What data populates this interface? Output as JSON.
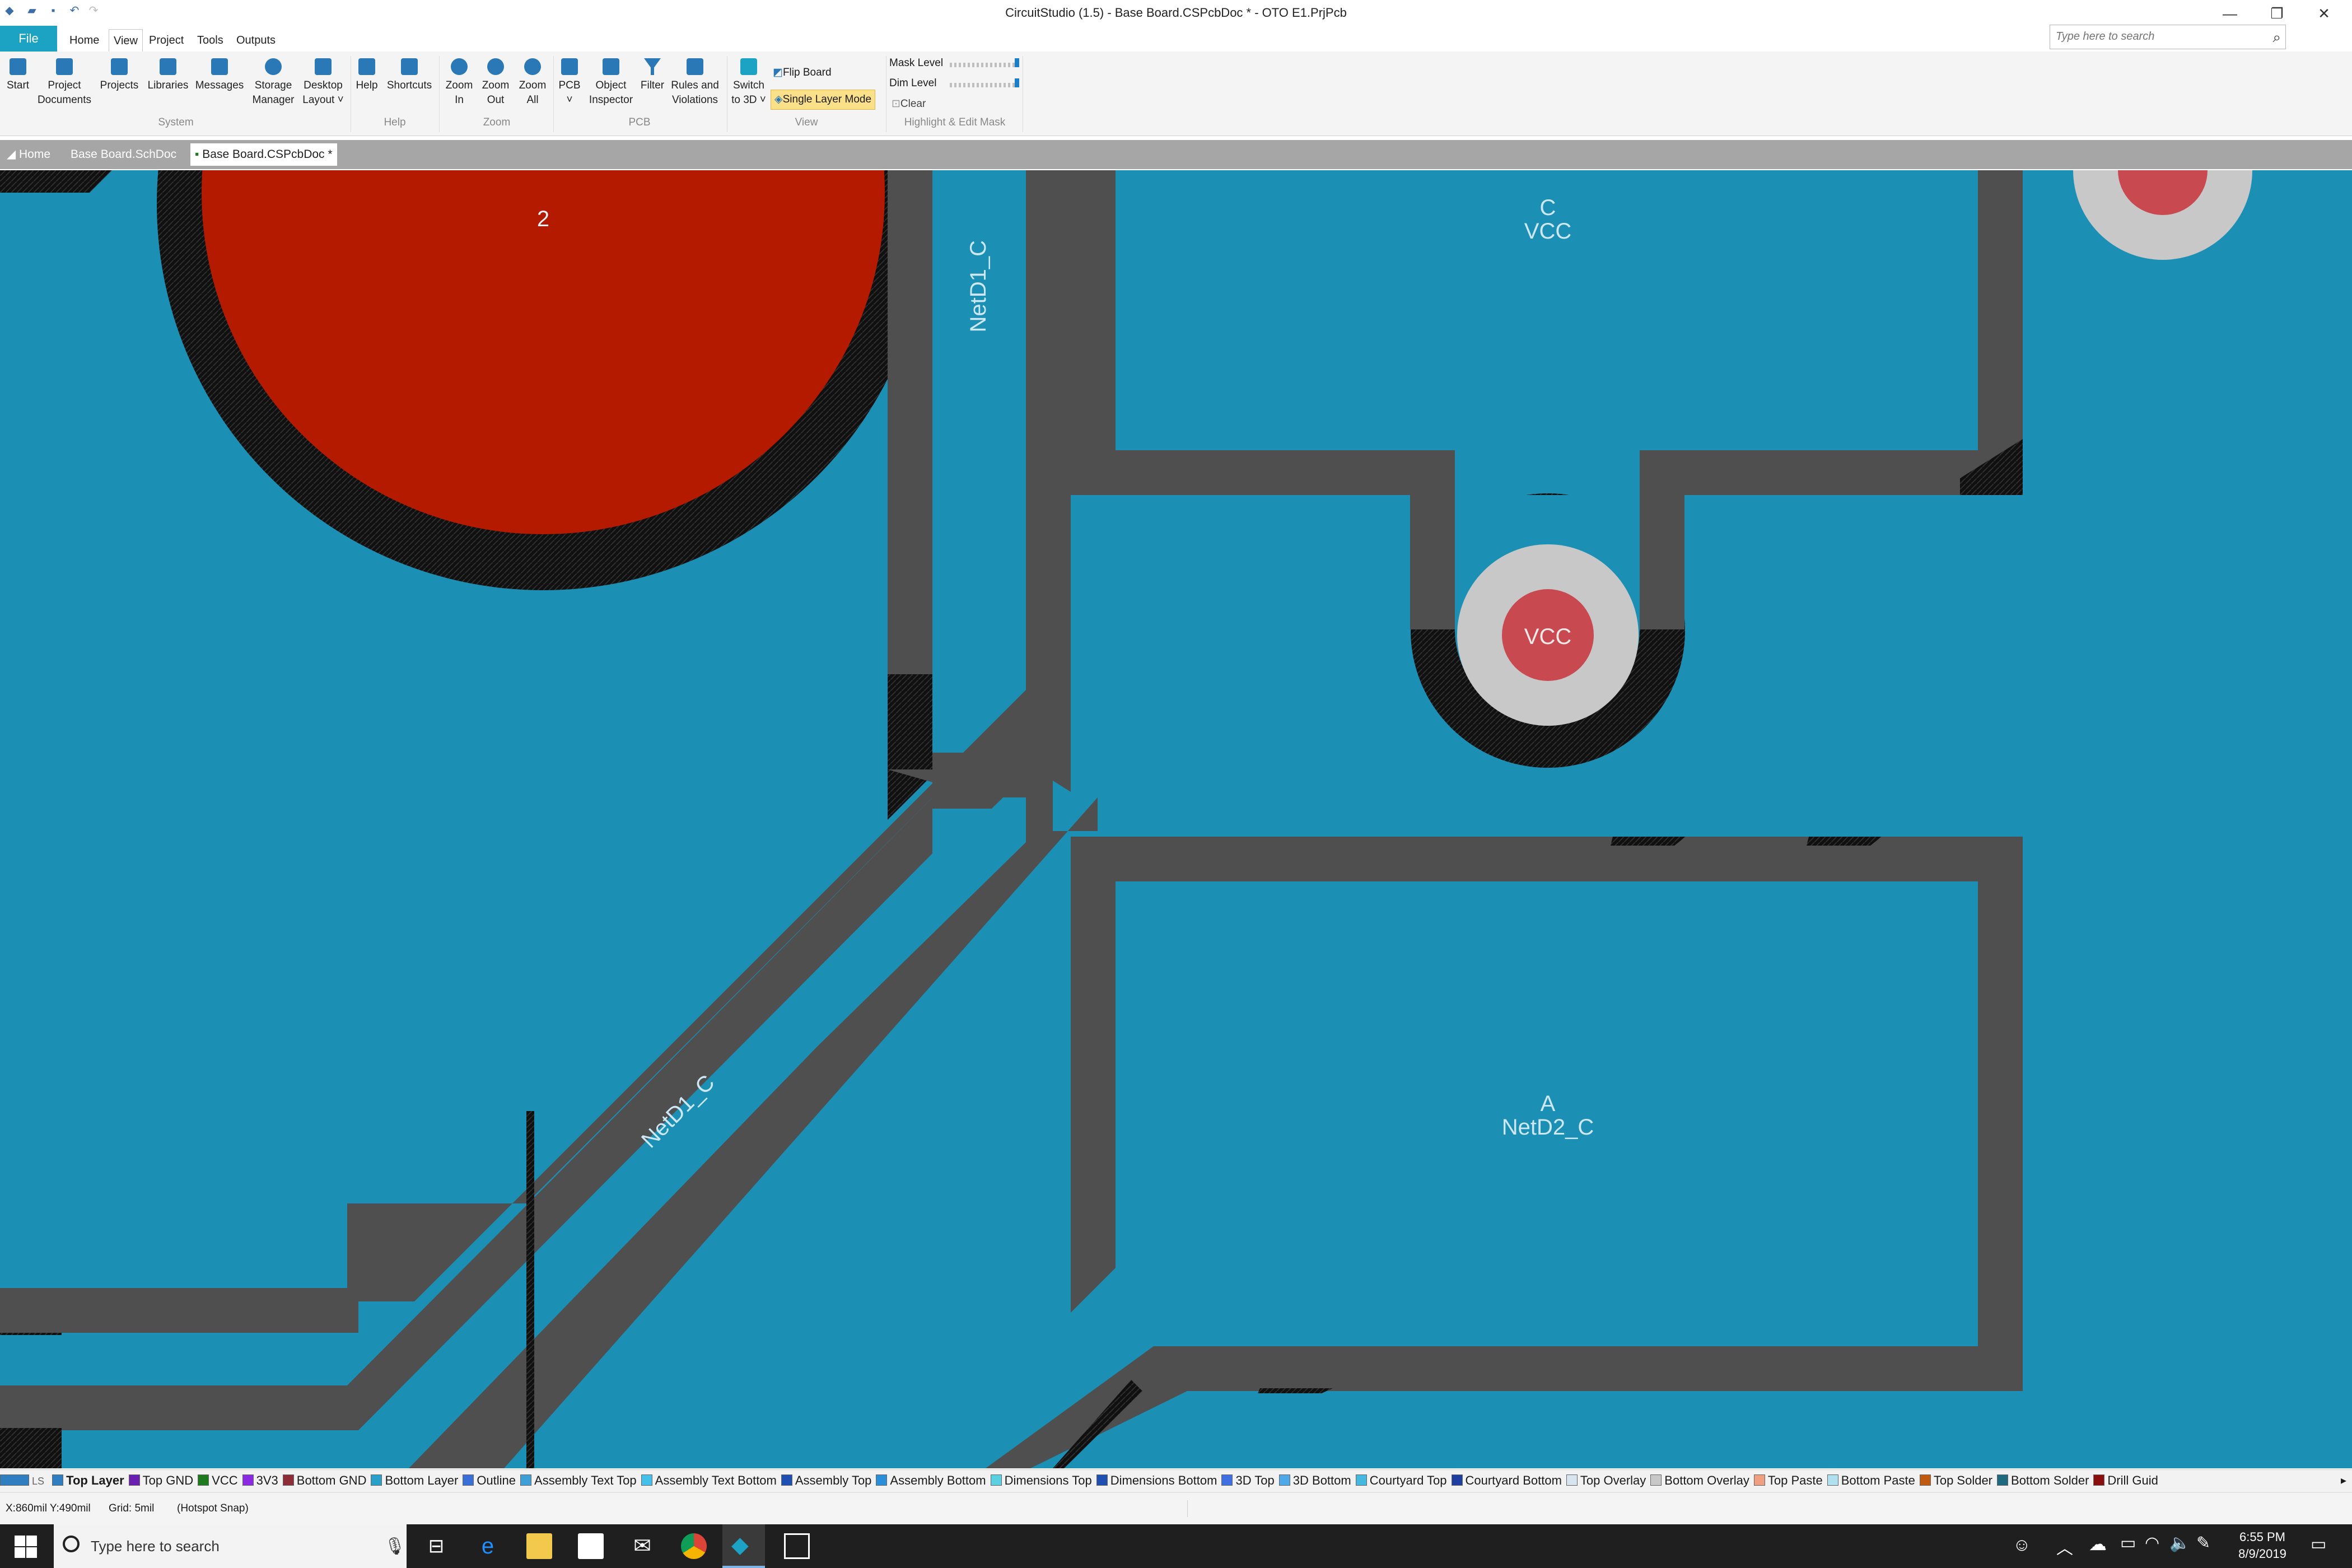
{
  "window": {
    "title": "CircuitStudio (1.5) - Base Board.CSPcbDoc * - OTO E1.PrjPcb",
    "controls": {
      "minimize": "—",
      "restore": "❐",
      "close": "✕"
    }
  },
  "menu": {
    "file": "File",
    "tabs": [
      "Home",
      "View",
      "Project",
      "Tools",
      "Outputs"
    ],
    "active_tab": "View",
    "search_placeholder": "Type here to search"
  },
  "ribbon": {
    "system": {
      "group_label": "System",
      "start": "Start",
      "project_documents_1": "Project",
      "project_documents_2": "Documents",
      "projects": "Projects",
      "libraries": "Libraries",
      "messages": "Messages",
      "storage_1": "Storage",
      "storage_2": "Manager",
      "desktop_1": "Desktop",
      "desktop_2": "Layout ˅"
    },
    "help": {
      "group_label": "Help",
      "help": "Help",
      "shortcuts": "Shortcuts"
    },
    "zoom": {
      "group_label": "Zoom",
      "zoom_in_1": "Zoom",
      "zoom_in_2": "In",
      "zoom_out_1": "Zoom",
      "zoom_out_2": "Out",
      "zoom_all_1": "Zoom",
      "zoom_all_2": "All"
    },
    "pcb": {
      "group_label": "PCB",
      "pcb": "PCB",
      "pcb_arrow": "˅",
      "object_1": "Object",
      "object_2": "Inspector",
      "filter": "Filter",
      "rules_1": "Rules and",
      "rules_2": "Violations"
    },
    "view": {
      "group_label": "View",
      "switch_1": "Switch",
      "switch_2": "to 3D ˅",
      "flip_board": "Flip Board",
      "single_layer": "Single Layer Mode"
    },
    "mask": {
      "group_label": "Highlight & Edit Mask",
      "mask_level": "Mask Level",
      "dim_level": "Dim Level",
      "clear": "Clear"
    }
  },
  "doc_tabs": [
    "Home",
    "Base Board.SchDoc",
    "Base Board.CSPcbDoc *"
  ],
  "pcb": {
    "pad_number": "2",
    "label_netd1_vertical": "NetD1_C",
    "label_netd1_diagonal": "NetD1_C",
    "label_c": "C",
    "label_vcc_top": "VCC",
    "via_vcc": "VCC",
    "label_a": "A",
    "label_netd2": "NetD2_C"
  },
  "layers": {
    "current": "LS",
    "items": [
      {
        "name": "Top Layer",
        "color": "#2f7fc0"
      },
      {
        "name": "Top GND",
        "color": "#6a1fb0"
      },
      {
        "name": "VCC",
        "color": "#1f7a1f"
      },
      {
        "name": "3V3",
        "color": "#8a2be2"
      },
      {
        "name": "Bottom GND",
        "color": "#8e2d3a"
      },
      {
        "name": "Bottom Layer",
        "color": "#2aa0c8"
      },
      {
        "name": "Outline",
        "color": "#3a6fd8"
      },
      {
        "name": "Assembly Text Top",
        "color": "#3fa0d8"
      },
      {
        "name": "Assembly Text Bottom",
        "color": "#45c0e8"
      },
      {
        "name": "Assembly Top",
        "color": "#1f4fb0"
      },
      {
        "name": "Assembly Bottom",
        "color": "#2a8fd8"
      },
      {
        "name": "Dimensions Top",
        "color": "#5bd0e0"
      },
      {
        "name": "Dimensions Bottom",
        "color": "#1f4fb0"
      },
      {
        "name": "3D Top",
        "color": "#3f6fe0"
      },
      {
        "name": "3D Bottom",
        "color": "#4fa8e8"
      },
      {
        "name": "Courtyard Top",
        "color": "#45b8e0"
      },
      {
        "name": "Courtyard Bottom",
        "color": "#1f3fa0"
      },
      {
        "name": "Top Overlay",
        "color": "#d8e4f0"
      },
      {
        "name": "Bottom Overlay",
        "color": "#c8c8c8"
      },
      {
        "name": "Top Paste",
        "color": "#f0a080"
      },
      {
        "name": "Bottom Paste",
        "color": "#b0e0f0"
      },
      {
        "name": "Top Solder",
        "color": "#c05a10"
      },
      {
        "name": "Bottom Solder",
        "color": "#1f6a80"
      },
      {
        "name": "Drill Guid",
        "color": "#8a1010"
      }
    ]
  },
  "status": {
    "coords": "X:860mil Y:490mil",
    "grid": "Grid: 5mil",
    "snap": "(Hotspot Snap)"
  },
  "taskbar": {
    "search_placeholder": "Type here to search",
    "time": "6:55 PM",
    "date": "8/9/2019"
  },
  "colors": {
    "copper": "#1c8fb5",
    "clearance": "#4f4f4f",
    "pad_red": "#b41a00",
    "via_ring": "#c8c8c8",
    "via_hole": "#c84a50",
    "label_text": "#cde8f4",
    "accent": "#1ca3c4"
  }
}
